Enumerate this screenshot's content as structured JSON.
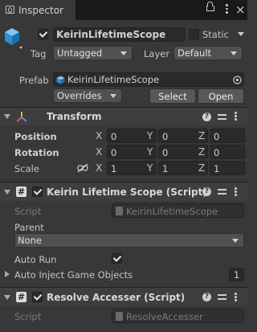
{
  "tab": {
    "title": "Inspector"
  },
  "object": {
    "name": "KeirinLifetimeScope",
    "static_label": "Static",
    "tag_label": "Tag",
    "tag_value": "Untagged",
    "layer_label": "Layer",
    "layer_value": "Default",
    "prefab_label": "Prefab",
    "prefab_value": "KeirinLifetimeScope",
    "overrides_label": "Overrides",
    "select_label": "Select",
    "open_label": "Open"
  },
  "transform": {
    "title": "Transform",
    "position_label": "Position",
    "rotation_label": "Rotation",
    "scale_label": "Scale",
    "axis_x": "X",
    "axis_y": "Y",
    "axis_z": "Z",
    "position": [
      "0",
      "0",
      "0"
    ],
    "rotation": [
      "0",
      "0",
      "0"
    ],
    "scale": [
      "1",
      "1",
      "1"
    ]
  },
  "lifetime_scope": {
    "title": "Keirin Lifetime Scope (Script)",
    "script_label": "Script",
    "script_value": "KeirinLifetimeScope",
    "parent_label": "Parent",
    "parent_value": "None",
    "auto_run_label": "Auto Run",
    "auto_inject_label": "Auto Inject Game Objects",
    "auto_inject_count": "1"
  },
  "resolve_accesser": {
    "title": "Resolve Accesser (Script)",
    "script_label": "Script",
    "script_value": "ResolveAccesser"
  },
  "colors": {
    "background": "#383838",
    "header": "#3e3e3e",
    "field": "#2a2a2a",
    "cube": "#3aa0e0"
  },
  "icons": [
    "inspector-icon",
    "lock-icon",
    "kebab-icon",
    "close-icon",
    "cube-icon",
    "prefab-icon",
    "target-icon",
    "transform-icon",
    "link-icon",
    "script-icon",
    "help-icon",
    "preset-icon",
    "checkmark-icon"
  ]
}
